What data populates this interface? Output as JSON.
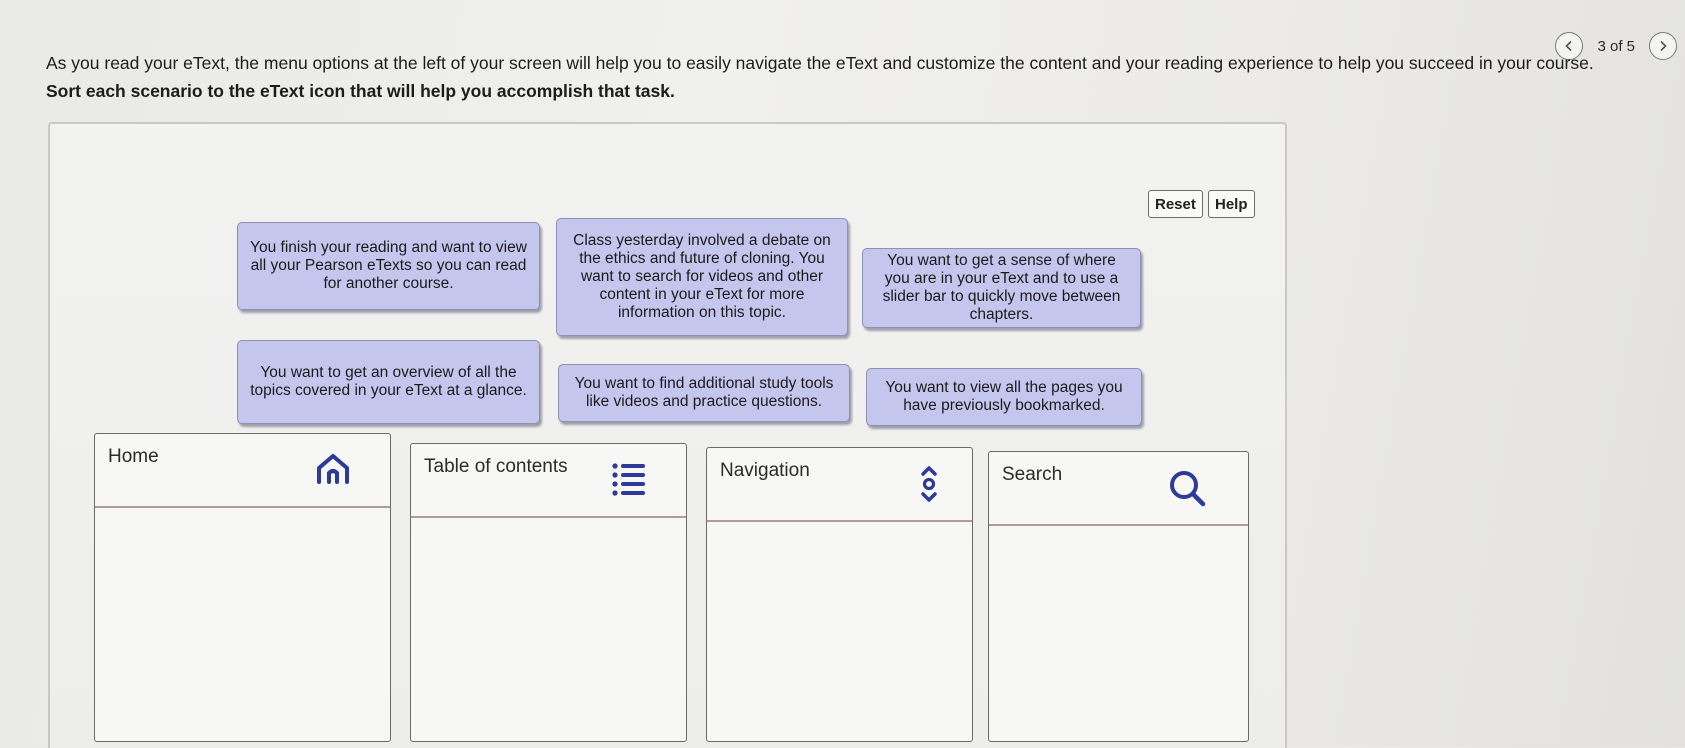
{
  "pager": {
    "text": "3 of 5",
    "prev_icon": "chevron-left-icon",
    "next_icon": "chevron-right-icon"
  },
  "intro": {
    "text": "As you read your eText, the menu options at the left of your screen will help you to easily navigate the eText and customize the content and your reading experience to help you succeed in your course.",
    "instruction": "Sort each scenario to the eText icon that will help you accomplish that task."
  },
  "toolbar": {
    "reset_label": "Reset",
    "help_label": "Help"
  },
  "cards": [
    "You finish your reading and want to view all your Pearson eTexts so you can read for another course.",
    "Class yesterday involved a debate on the ethics and future of cloning. You want to search for videos and other content in your eText for more information on this topic.",
    "You want to get a sense of where you are in your eText and to use a slider bar to quickly move between chapters.",
    "You want to get an overview of all the topics covered in your eText at a glance.",
    "You want to find additional study tools like videos and practice questions.",
    "You want to view all the pages you have previously bookmarked."
  ],
  "bins": [
    {
      "label": "Home",
      "icon": "home-icon"
    },
    {
      "label": "Table of contents",
      "icon": "list-icon"
    },
    {
      "label": "Navigation",
      "icon": "navigation-arrows-icon"
    },
    {
      "label": "Search",
      "icon": "search-icon"
    }
  ],
  "colors": {
    "card_fill": "#c5c6ee",
    "card_border": "#8d8fb5",
    "bin_divider": "#b19b93"
  }
}
